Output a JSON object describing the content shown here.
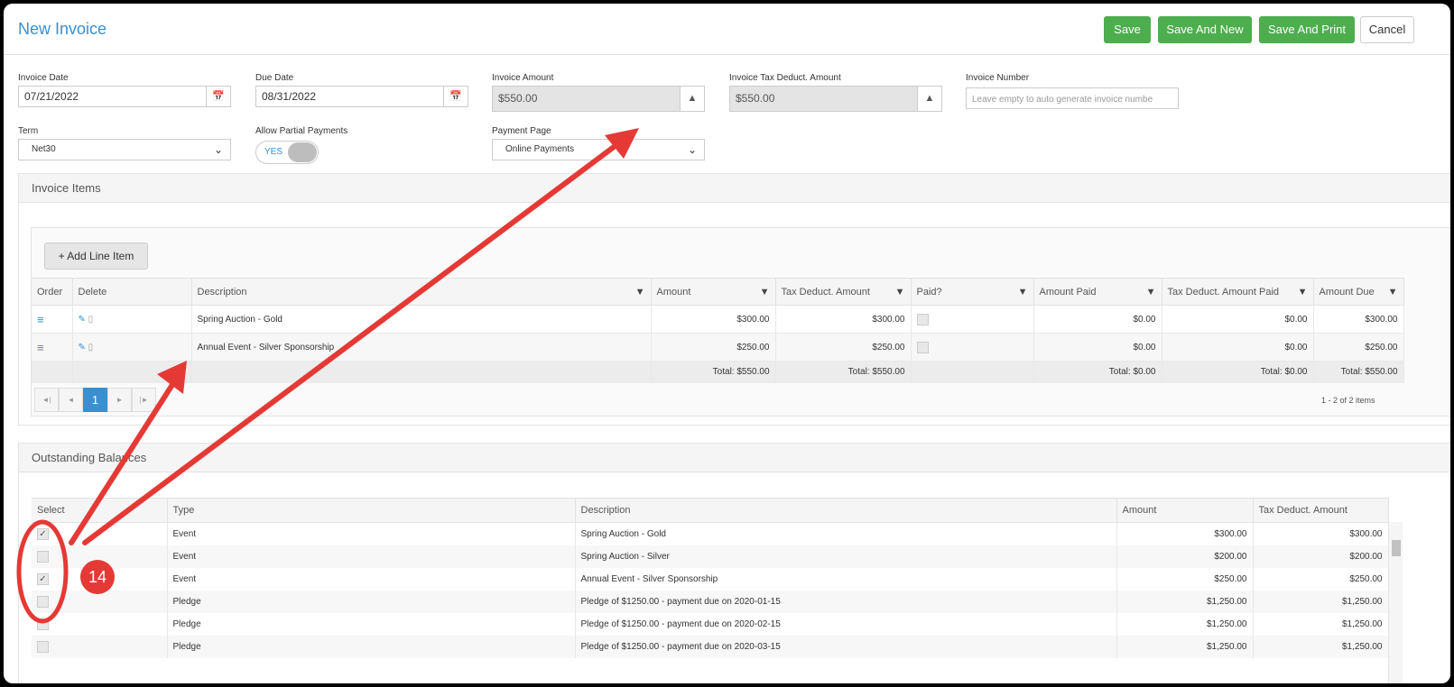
{
  "header": {
    "title": "New Invoice",
    "save_label": "Save",
    "save_new_label": "Save And New",
    "save_print_label": "Save And Print",
    "cancel_label": "Cancel"
  },
  "form": {
    "invoice_date_label": "Invoice Date",
    "invoice_date_value": "07/21/2022",
    "due_date_label": "Due Date",
    "due_date_value": "08/31/2022",
    "invoice_amount_label": "Invoice Amount",
    "invoice_amount_value": "$550.00",
    "tax_deduct_label": "Invoice Tax Deduct. Amount",
    "tax_deduct_value": "$550.00",
    "invoice_number_label": "Invoice Number",
    "invoice_number_placeholder": "Leave empty to auto generate invoice numbe",
    "term_label": "Term",
    "term_value": "Net30",
    "partial_label": "Allow Partial Payments",
    "partial_value": "YES",
    "payment_page_label": "Payment Page",
    "payment_page_value": "Online Payments"
  },
  "invoice_items": {
    "panel_title": "Invoice Items",
    "add_label": "+ Add Line Item",
    "columns": [
      "Order",
      "Delete",
      "Description",
      "Amount",
      "Tax Deduct. Amount",
      "Paid?",
      "Amount Paid",
      "Tax Deduct. Amount Paid",
      "Amount Due"
    ],
    "rows": [
      {
        "description": "Spring Auction - Gold",
        "amount": "$300.00",
        "tax": "$300.00",
        "paid_amt": "$0.00",
        "tax_paid": "$0.00",
        "due": "$300.00"
      },
      {
        "description": "Annual Event - Silver Sponsorship",
        "amount": "$250.00",
        "tax": "$250.00",
        "paid_amt": "$0.00",
        "tax_paid": "$0.00",
        "due": "$250.00"
      }
    ],
    "totals": {
      "amount": "Total: $550.00",
      "tax": "Total: $550.00",
      "paid": "Total: $0.00",
      "tax_paid": "Total: $0.00",
      "due": "Total: $550.00"
    },
    "page": "1",
    "pager_info": "1 - 2 of 2 items"
  },
  "outstanding": {
    "panel_title": "Outstanding Balances",
    "columns": [
      "Select",
      "Type",
      "Description",
      "Amount",
      "Tax Deduct. Amount"
    ],
    "rows": [
      {
        "checked": true,
        "type": "Event",
        "description": "Spring Auction - Gold",
        "amount": "$300.00",
        "tax": "$300.00"
      },
      {
        "checked": false,
        "type": "Event",
        "description": "Spring Auction - Silver",
        "amount": "$200.00",
        "tax": "$200.00"
      },
      {
        "checked": true,
        "type": "Event",
        "description": "Annual Event - Silver Sponsorship",
        "amount": "$250.00",
        "tax": "$250.00"
      },
      {
        "checked": false,
        "type": "Pledge",
        "description": "Pledge of $1250.00 - payment due on 2020-01-15",
        "amount": "$1,250.00",
        "tax": "$1,250.00"
      },
      {
        "checked": false,
        "type": "Pledge",
        "description": "Pledge of $1250.00 - payment due on 2020-02-15",
        "amount": "$1,250.00",
        "tax": "$1,250.00"
      },
      {
        "checked": false,
        "type": "Pledge",
        "description": "Pledge of $1250.00 - payment due on 2020-03-15",
        "amount": "$1,250.00",
        "tax": "$1,250.00"
      }
    ]
  },
  "annotation": {
    "step_number": "14",
    "color": "#e53935"
  }
}
